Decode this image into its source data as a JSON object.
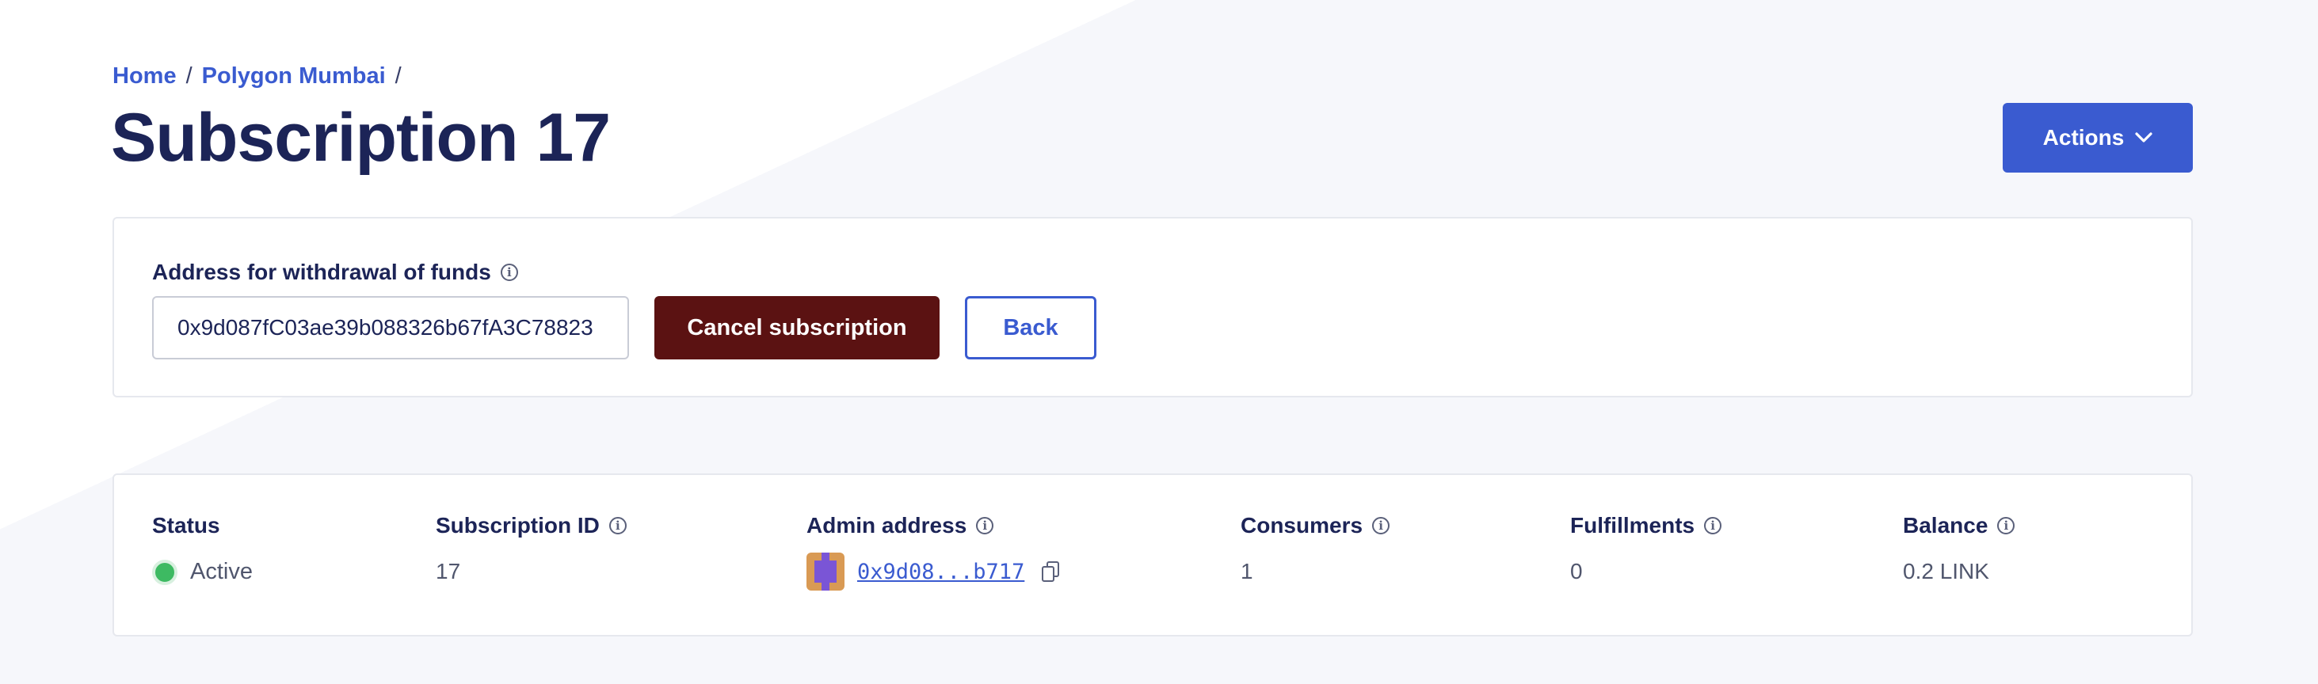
{
  "breadcrumb": {
    "home": "Home",
    "network": "Polygon Mumbai",
    "separator": "/"
  },
  "page": {
    "title": "Subscription 17"
  },
  "header": {
    "actions_label": "Actions"
  },
  "withdraw": {
    "label": "Address for withdrawal of funds",
    "address_value": "0x9d087fC03ae39b088326b67fA3C78823",
    "cancel_label": "Cancel subscription",
    "back_label": "Back"
  },
  "details": {
    "status": {
      "label": "Status",
      "value": "Active"
    },
    "subscription_id": {
      "label": "Subscription ID",
      "value": "17"
    },
    "admin_address": {
      "label": "Admin address",
      "value": "0x9d08...b717"
    },
    "consumers": {
      "label": "Consumers",
      "value": "1"
    },
    "fulfillments": {
      "label": "Fulfillments",
      "value": "0"
    },
    "balance": {
      "label": "Balance",
      "value": "0.2 LINK"
    }
  },
  "icons": {
    "info": "info-icon",
    "chevron": "chevron-down-icon",
    "copy": "copy-icon",
    "status": "status-dot"
  },
  "colors": {
    "primary": "#3a5bd0",
    "danger_dark": "#5b1212",
    "active_status": "#3dba62",
    "title": "#1c2457"
  }
}
